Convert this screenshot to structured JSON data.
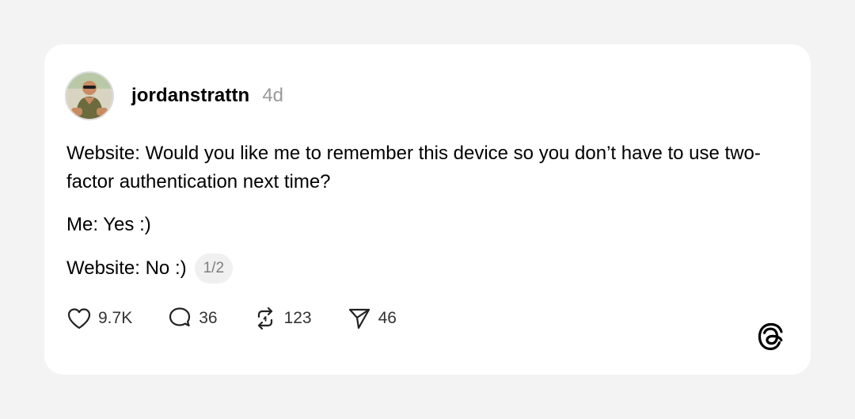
{
  "post": {
    "username": "jordanstrattn",
    "time": "4d",
    "lines": [
      "Website: Would you like me to remember this device so you don’t have to use two-factor authentication next time?",
      "Me: Yes :)",
      "Website: No :)"
    ],
    "page_indicator": "1/2"
  },
  "actions": {
    "likes": "9.7K",
    "replies": "36",
    "reposts": "123",
    "shares": "46"
  },
  "icons": {
    "like": "heart-icon",
    "reply": "comment-icon",
    "repost": "repost-icon",
    "share": "send-icon",
    "brand": "threads-logo-icon"
  },
  "colors": {
    "page_background": "#f3f3f3",
    "card_background": "#ffffff",
    "muted_text": "#9a9a9a"
  }
}
